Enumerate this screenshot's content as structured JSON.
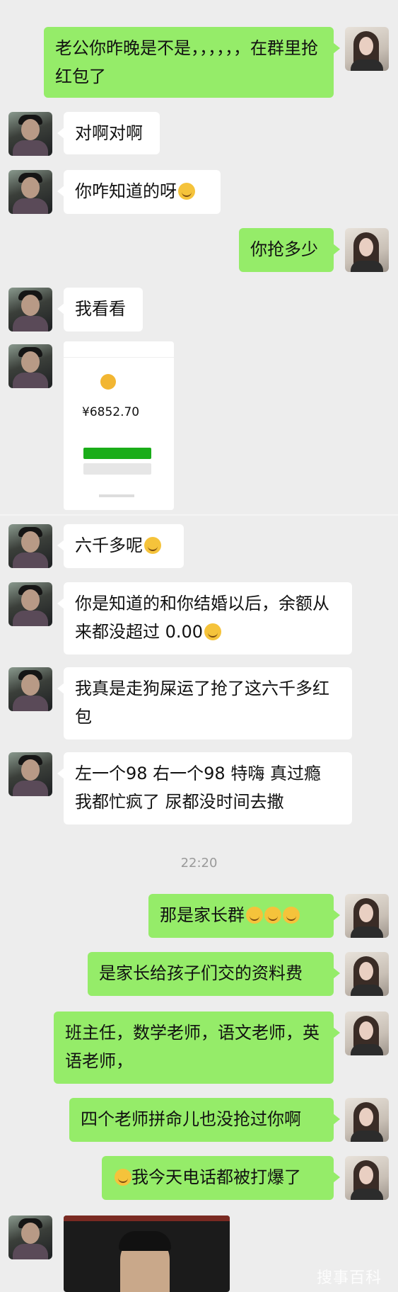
{
  "chat": {
    "messages": [
      {
        "text": "老公你昨晚是不是，，，，，，在群里抢红包了"
      },
      {
        "text": "对啊对啊"
      },
      {
        "text": "你咋知道的呀"
      },
      {
        "text": "你抢多少"
      },
      {
        "text": "我看看"
      },
      {
        "text": "六千多呢"
      },
      {
        "text": "你是知道的和你结婚以后，余额从来都没超过 0.00"
      },
      {
        "text": "我真是走狗屎运了抢了这六千多红包"
      },
      {
        "text": "左一个98  右一个98  特嗨  真过瘾  我都忙疯了  尿都没时间去撒"
      },
      {
        "text": "那是家长群"
      },
      {
        "text": "是家长给孩子们交的资料费"
      },
      {
        "text": "班主任，数学老师，语文老师，英语老师，"
      },
      {
        "text": "四个老师拼命儿也没抢过你啊"
      },
      {
        "text": "我今天电话都被打爆了"
      }
    ],
    "timestamp": "22:20",
    "wallet_screenshot": {
      "amount": "¥6852.70"
    },
    "watermark": "搜事百科"
  },
  "colors": {
    "sent_bubble": "#95ec69",
    "received_bubble": "#ffffff",
    "background": "#ededed"
  }
}
